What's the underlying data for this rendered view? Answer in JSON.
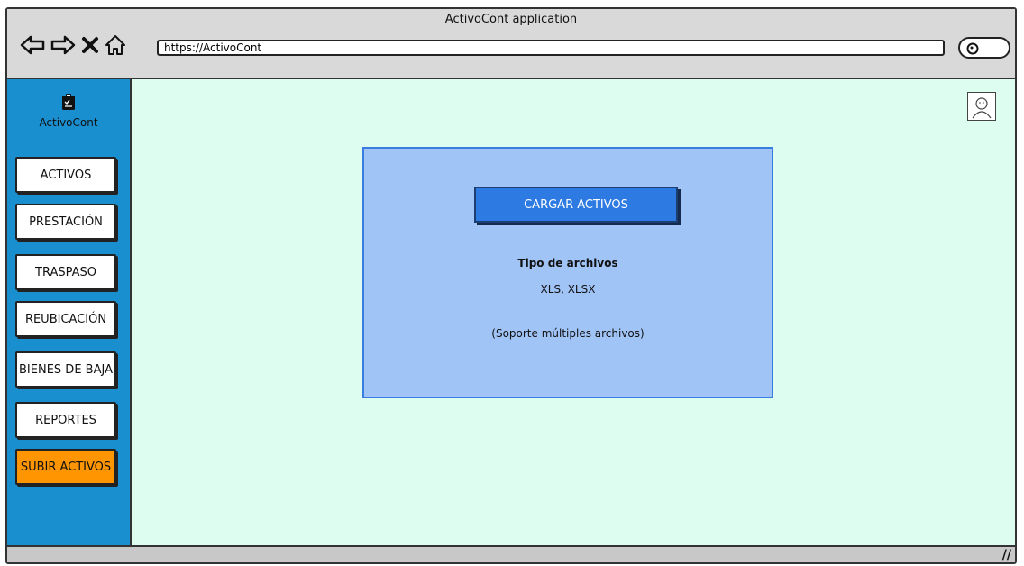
{
  "window": {
    "title": "ActivoCont application"
  },
  "browser": {
    "url": "https://ActivoCont",
    "icons": [
      "back-arrow-icon",
      "forward-arrow-icon",
      "close-x-icon",
      "home-icon",
      "search-icon"
    ]
  },
  "sidebar": {
    "logo_label": "ActivoCont",
    "items": [
      {
        "label": "ACTIVOS"
      },
      {
        "label": "PRESTACIÓN"
      },
      {
        "label": "TRASPASO"
      },
      {
        "label": "REUBICACIÓN"
      },
      {
        "label": "BIENES DE BAJA"
      },
      {
        "label": "REPORTES"
      },
      {
        "label": "SUBIR ACTIVOS",
        "active": true
      }
    ]
  },
  "upload_panel": {
    "button_label": "CARGAR ACTIVOS",
    "types_title": "Tipo de archivos",
    "types_value": "XLS, XLSX",
    "support_note": "(Soporte múltiples archivos)"
  },
  "colors": {
    "sidebar": "#1a8fd0",
    "main_bg": "#dcfdef",
    "panel_bg": "#a1c4f7",
    "button_bg": "#2d7ae2",
    "active_item": "#ff9500"
  }
}
